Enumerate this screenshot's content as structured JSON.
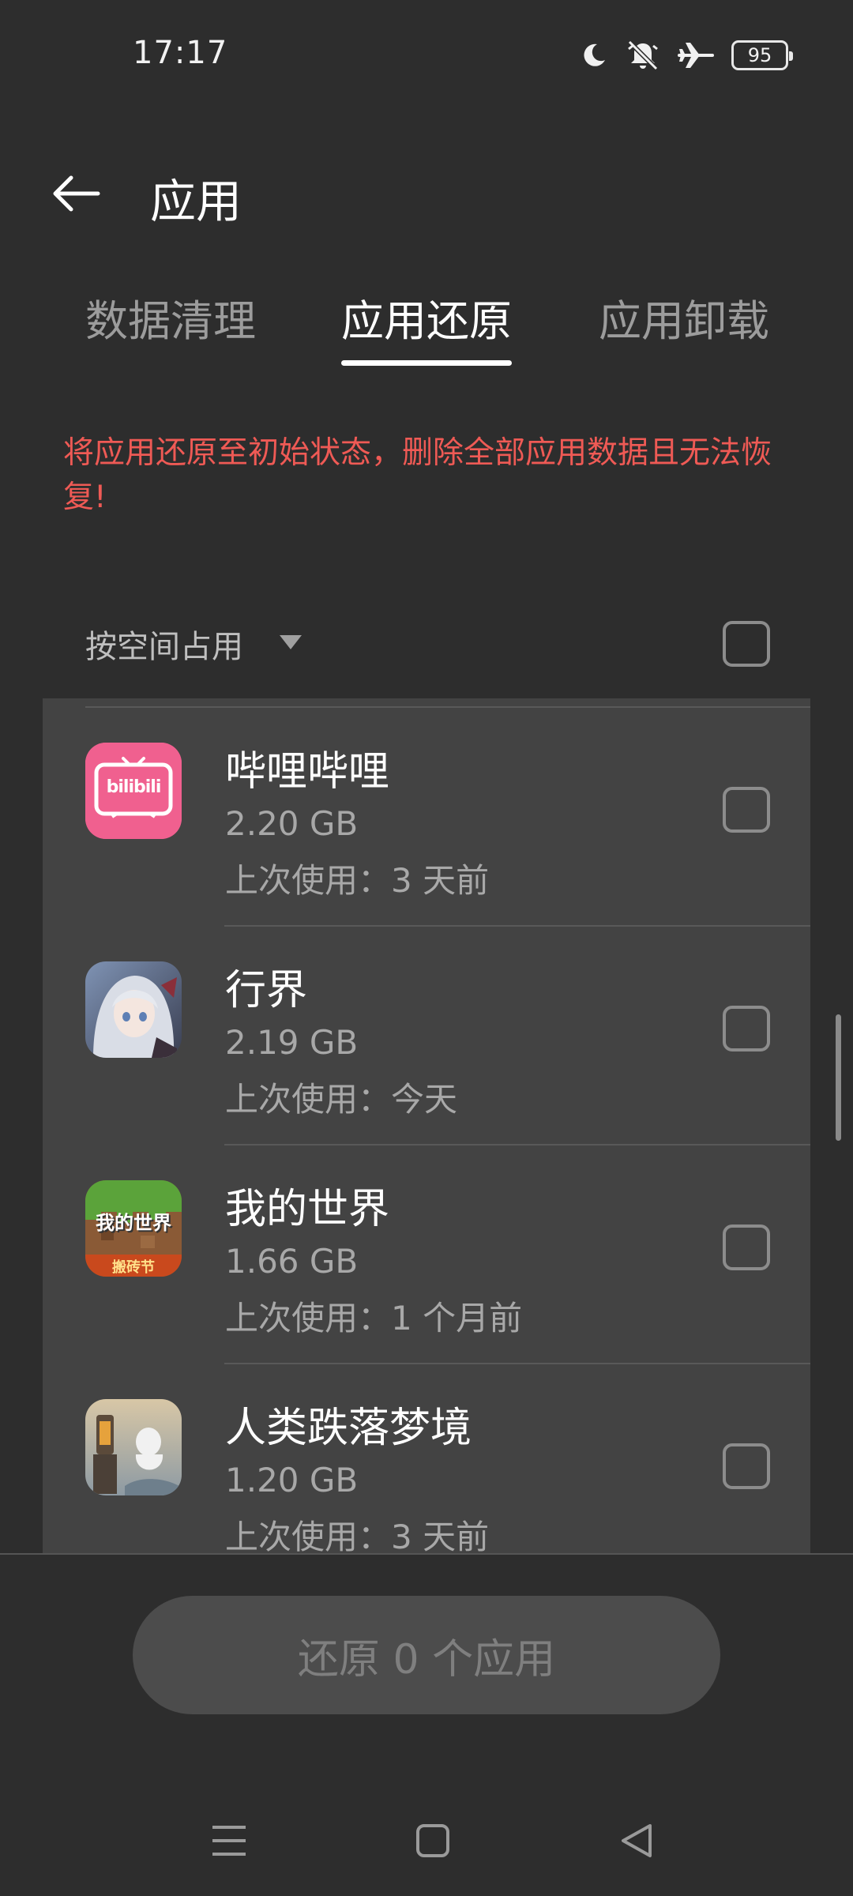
{
  "status_bar": {
    "time": "17:17",
    "battery": "95",
    "icons": [
      "moon-icon",
      "bell-muted-icon",
      "airplane-icon",
      "battery-icon"
    ]
  },
  "header": {
    "title": "应用",
    "back_icon": "arrow-left-icon"
  },
  "tabs": [
    {
      "label": "数据清理",
      "active": false
    },
    {
      "label": "应用还原",
      "active": true
    },
    {
      "label": "应用卸载",
      "active": false
    }
  ],
  "warning": "将应用还原至初始状态，删除全部应用数据且无法恢复!",
  "sort": {
    "label": "按空间占用",
    "icon": "caret-down-icon",
    "select_all_checked": false
  },
  "apps": [
    {
      "name": "哔哩哔哩",
      "size": "2.20 GB",
      "last_used": "上次使用：3 天前",
      "icon_text": "bilibili",
      "checked": false
    },
    {
      "name": "行界",
      "size": "2.19 GB",
      "last_used": "上次使用：今天",
      "icon_text": "",
      "checked": false
    },
    {
      "name": "我的世界",
      "size": "1.66 GB",
      "last_used": "上次使用：1 个月前",
      "icon_text": "我的世界",
      "icon_subtext": "搬砖节",
      "checked": false
    },
    {
      "name": "人类跌落梦境",
      "size": "1.20 GB",
      "last_used": "上次使用：3 天前",
      "icon_text": "",
      "checked": false
    }
  ],
  "restore_button": "还原 0 个应用",
  "nav": [
    "menu-icon",
    "home-square-icon",
    "back-triangle-icon"
  ],
  "colors": {
    "background": "#2d2d2d",
    "panel": "#434343",
    "warning": "#ef5a55",
    "bilibili_pink": "#f0608f"
  }
}
